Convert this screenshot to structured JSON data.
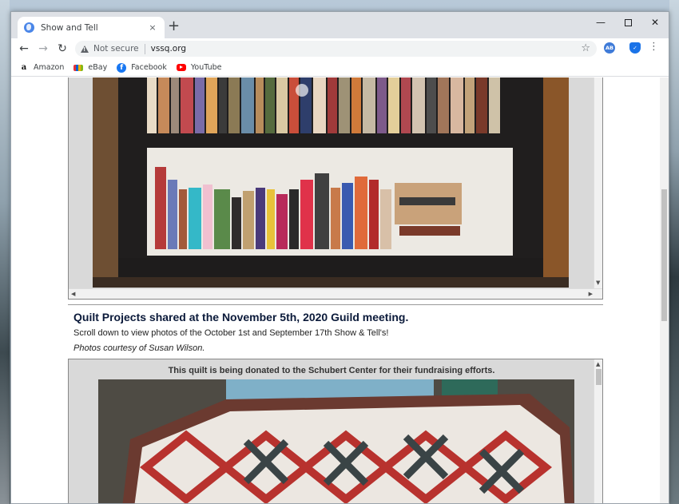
{
  "browser": {
    "tab_title": "Show and Tell",
    "tab_close": "×",
    "new_tab": "+",
    "security_label": "Not secure",
    "url": "vssq.org",
    "star_icon": "☆",
    "ext_ab": "AB",
    "ext_shield": "✓",
    "menu_icon": "⋮",
    "back": "←",
    "forward": "→",
    "reload": "↻",
    "minimize": "—",
    "close": "✕"
  },
  "bookmarks": [
    {
      "label": "Amazon",
      "icon": "amazon-icon"
    },
    {
      "label": "eBay",
      "icon": "ebay-icon"
    },
    {
      "label": "Facebook",
      "icon": "facebook-icon"
    },
    {
      "label": "YouTube",
      "icon": "youtube-icon"
    }
  ],
  "page": {
    "heading": "Quilt Projects shared at the November 5th, 2020 Guild meeting.",
    "subtext": "Scroll down to view photos of the October 1st and September 17th Show & Tell's!",
    "credit": "Photos courtesy of Susan Wilson.",
    "caption": "This quilt is being donated to the Schubert Center for their fundraising efforts."
  },
  "colors": {
    "heading": "#0b1a3a",
    "frame_bg": "#d9d9d9"
  }
}
